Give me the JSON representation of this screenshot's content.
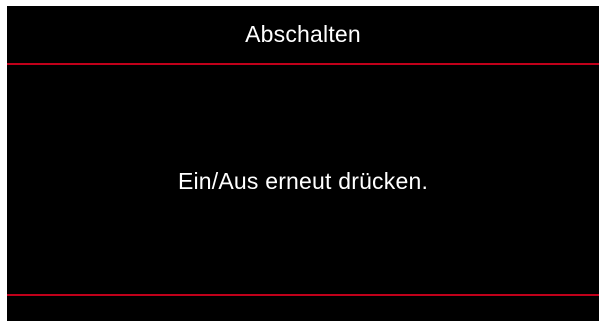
{
  "dialog": {
    "title": "Abschalten",
    "message": "Ein/Aus erneut drücken."
  },
  "colors": {
    "background": "#000000",
    "text": "#ffffff",
    "accent_line": "#c0001a"
  }
}
